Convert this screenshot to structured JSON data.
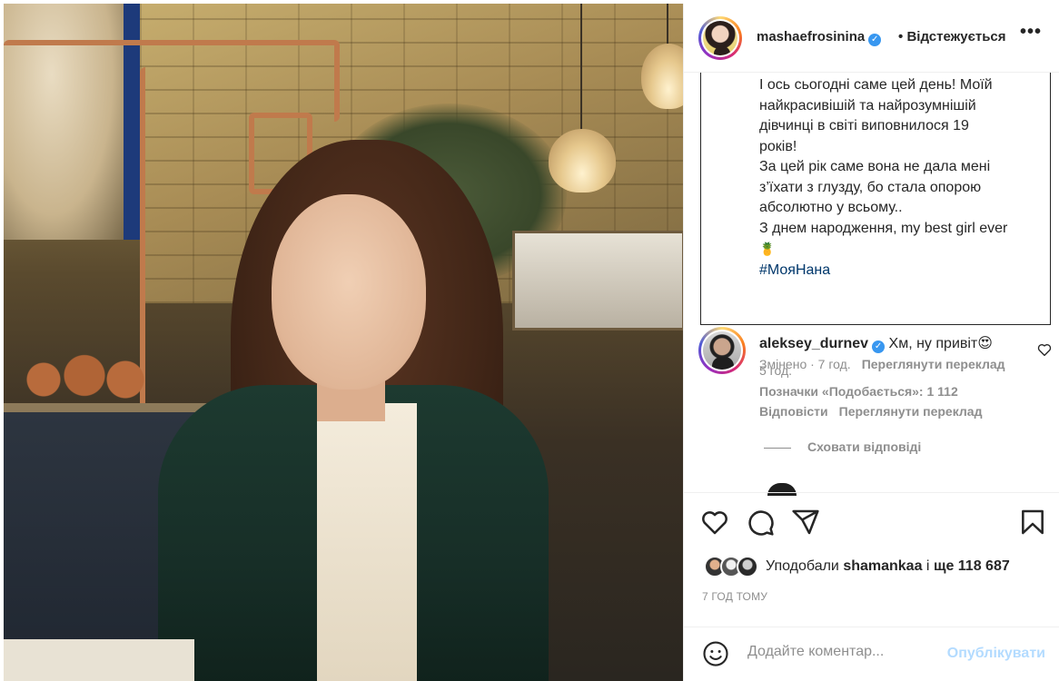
{
  "post": {
    "username": "mashaefrosinina",
    "verified_mark": "✓",
    "follow_dot": "•",
    "follow_label": "Відстежується",
    "more_label": "•••"
  },
  "caption": {
    "lines": [
      "І ось сьогодні саме цей день! Моїй",
      "найкрасивішій та найрозумнішій",
      "дівчинці в світі виповнилося 19",
      "років!",
      "За цей рік саме вона не дала мені",
      "з’їхати з глузду, бо стала опорою",
      "абсолютно у всьому..",
      "З днем народження, my best girl ever"
    ],
    "emoji": "🍍",
    "hashtag": "#МояНана",
    "edited": "Змінено · 7 год.",
    "translate": "Переглянути переклад"
  },
  "comment": {
    "username": "aleksey_durnev",
    "verified_mark": "✓",
    "text": "Хм, ну привіт😍",
    "time": "5 год.",
    "likes": "Позначки «Подобається»: 1 112",
    "reply": "Відповісти",
    "translate": "Переглянути переклад",
    "hide_replies": "Сховати відповіді"
  },
  "likes": {
    "prefix": "Уподобали ",
    "user": "shamankaa",
    "middle": " і ",
    "count": "ще 118 687"
  },
  "post_time": "7 ГОД ТОМУ",
  "comment_bar": {
    "placeholder": "Додайте коментар...",
    "publish": "Опублікувати"
  },
  "icons": {
    "like": "heart-icon",
    "comment": "comment-icon",
    "share": "paper-plane-icon",
    "save": "bookmark-icon",
    "emoji": "emoji-icon"
  },
  "colors": {
    "link_blue": "#00376b",
    "verified_blue": "#3897f0",
    "publish_disabled": "#b3dbff",
    "muted_text": "#8e8e8e"
  }
}
